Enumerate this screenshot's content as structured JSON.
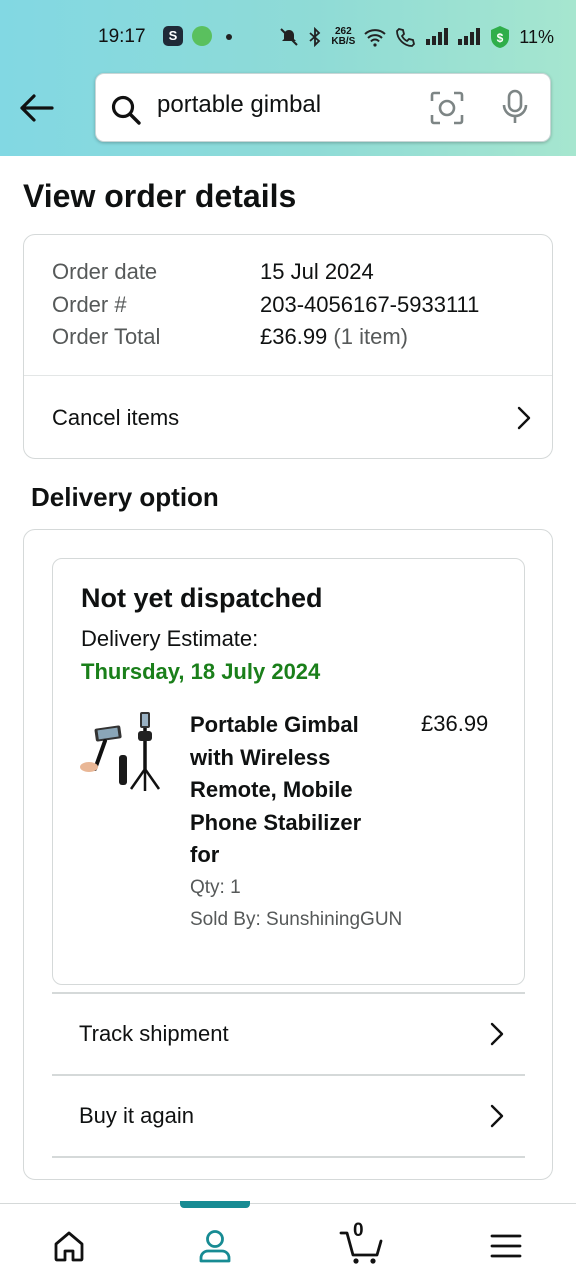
{
  "status_bar": {
    "time": "19:17",
    "net_speed_value": "262",
    "net_speed_unit": "KB/S",
    "battery": "11%"
  },
  "search": {
    "query": "portable gimbal"
  },
  "page": {
    "title": "View order details"
  },
  "order": {
    "date_label": "Order date",
    "date_value": "15 Jul 2024",
    "number_label": "Order #",
    "number_value": "203-4056167-5933111",
    "total_label": "Order Total",
    "total_value": "£36.99",
    "total_items": "(1 item)",
    "cancel_label": "Cancel items"
  },
  "delivery": {
    "section_title": "Delivery option",
    "status": "Not yet dispatched",
    "estimate_label": "Delivery Estimate:",
    "estimate_date": "Thursday, 18 July 2024",
    "product_title": "Portable Gimbal with Wireless Remote, Mobile Phone Stabilizer for",
    "price": "£36.99",
    "qty": "Qty: 1",
    "sold_by": "Sold By: SunshiningGUN",
    "track_label": "Track shipment",
    "buy_again_label": "Buy it again"
  },
  "bottom_nav": {
    "cart_count": "0",
    "active": "account"
  },
  "colors": {
    "header_gradient_start": "#82d8e3",
    "header_gradient_end": "#a6e6cf",
    "estimate_green": "#1a7f1a",
    "nav_active": "#178b93"
  }
}
